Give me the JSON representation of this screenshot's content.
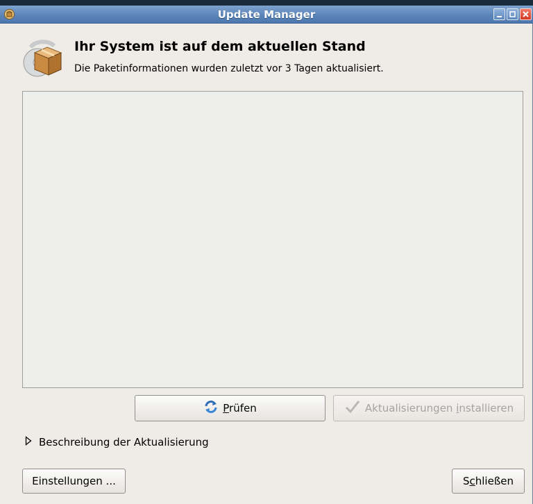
{
  "window": {
    "title": "Update Manager",
    "icons": {
      "app": "update-manager-icon",
      "minimize": "minimize-icon",
      "maximize": "maximize-icon",
      "close": "close-icon"
    }
  },
  "header": {
    "icon": "package-box-icon",
    "title": "Ihr System ist auf dem aktuellen Stand",
    "subtitle": "Die Paketinformationen wurden zuletzt vor 3 Tagen aktualisiert."
  },
  "update_list": {
    "items": []
  },
  "buttons": {
    "check": {
      "mnemonic": "P",
      "rest": "rüfen",
      "icon": "refresh-icon"
    },
    "install": {
      "before": "Aktualisierungen ",
      "mnemonic": "i",
      "after": "nstallieren",
      "icon": "checkmark-icon",
      "disabled": true
    },
    "settings": {
      "label": "Einstellungen ..."
    },
    "close": {
      "before": "S",
      "mnemonic": "c",
      "after": "hließen"
    }
  },
  "expander": {
    "label": "Beschreibung der Aktualisierung",
    "expanded": false,
    "icon": "expander-arrow-icon"
  },
  "colors": {
    "titlebar": "#5b84b9",
    "window_bg": "#efebe7",
    "close_button": "#d13a23"
  }
}
